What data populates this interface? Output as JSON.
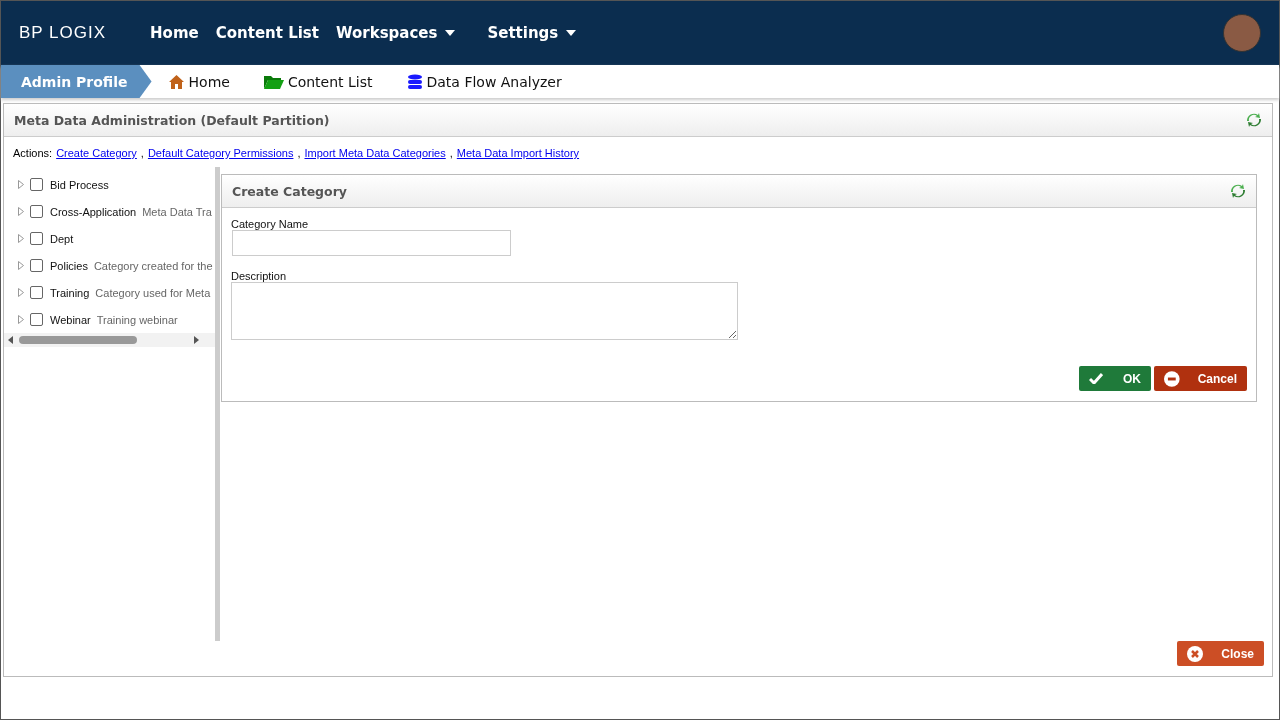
{
  "logo": "BP LOGIX",
  "nav": [
    {
      "label": "Home",
      "dropdown": false
    },
    {
      "label": "Content List",
      "dropdown": false
    },
    {
      "label": "Workspaces",
      "dropdown": true
    },
    {
      "label": "Settings",
      "dropdown": true
    }
  ],
  "breadcrumb": {
    "current": "Admin Profile",
    "links": [
      {
        "label": "Home",
        "kind": "home"
      },
      {
        "label": "Content List",
        "kind": "folder"
      },
      {
        "label": "Data Flow Analyzer",
        "kind": "database"
      }
    ]
  },
  "panel": {
    "title": "Meta Data Administration (Default Partition)",
    "actions_label": "Actions:",
    "separator": ",",
    "actions": [
      "Create Category",
      "Default Category Permissions",
      "Import Meta Data Categories",
      "Meta Data Import History"
    ]
  },
  "tree": [
    {
      "name": "Bid Process",
      "checked": false
    },
    {
      "name": "Cross-Application",
      "description": "Meta Data Tra",
      "checked": false
    },
    {
      "name": "Dept",
      "checked": false
    },
    {
      "name": "Policies",
      "description": "Category created for the",
      "checked": false
    },
    {
      "name": "Training",
      "description": "Category used for Meta",
      "checked": false
    },
    {
      "name": "Webinar",
      "description": "Training webinar",
      "checked": false
    }
  ],
  "form": {
    "title": "Create Category",
    "fields": [
      {
        "label": "Category Name",
        "kind": "text"
      },
      {
        "label": "Description",
        "kind": "textarea"
      }
    ],
    "ok": "OK",
    "cancel": "Cancel"
  },
  "close": "Close"
}
